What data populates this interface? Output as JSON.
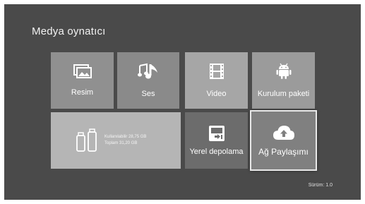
{
  "app": {
    "title": "Medya oynatıcı"
  },
  "tiles": {
    "resim": {
      "label": "Resim",
      "icon": "image-gallery-icon"
    },
    "ses": {
      "label": "Ses",
      "icon": "music-note-icon"
    },
    "video": {
      "label": "Video",
      "icon": "film-icon"
    },
    "kurulum": {
      "label": "Kurulum paketi",
      "icon": "android-icon"
    },
    "usb": {
      "icon": "usb-drive-icon",
      "available": "Kullanılabilir 28,75 GB",
      "total": "Toplam 31,20 GB"
    },
    "yerel": {
      "label": "Yerel depolama",
      "icon": "local-storage-icon"
    },
    "ag": {
      "label": "Ağ Paylaşımı",
      "icon": "cloud-upload-icon"
    }
  },
  "footer": {
    "version": "Sürüm: 1.0"
  },
  "colors": {
    "background": "#4a4a4a",
    "focus_border": "#e9e9e9"
  }
}
